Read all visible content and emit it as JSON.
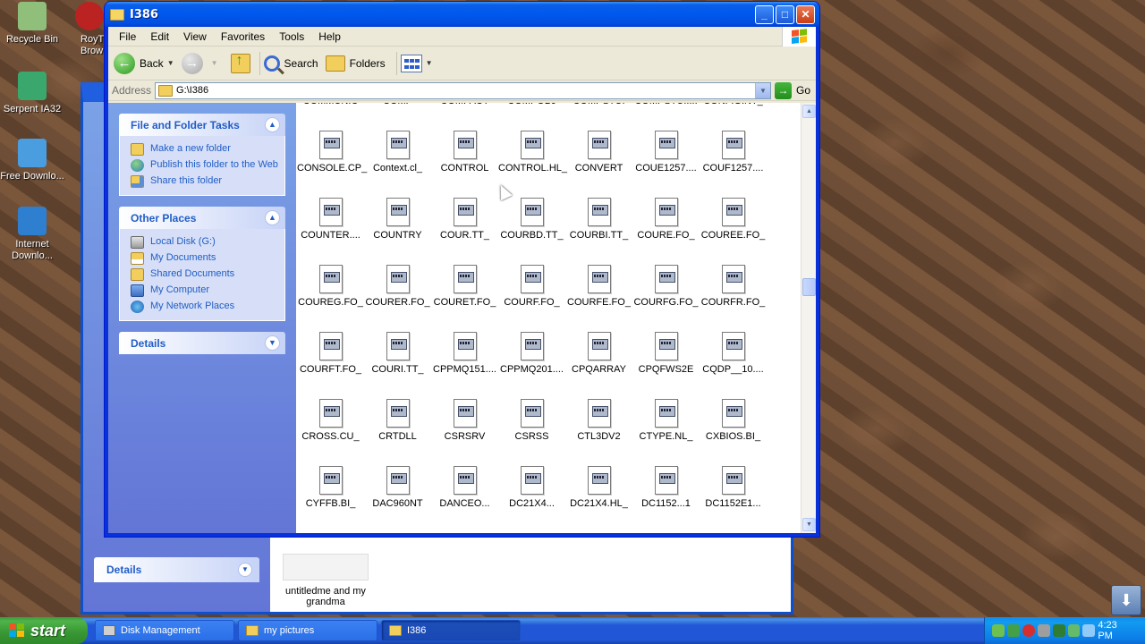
{
  "desktop": {
    "icons": [
      {
        "label": "Recycle Bin",
        "icon": "recycle-bin-icon",
        "color": "#8fbf7a"
      },
      {
        "label": "Serpent IA32",
        "icon": "serpent-icon",
        "color": "#3aa76d"
      },
      {
        "label": "Free Downlo...",
        "icon": "download-icon",
        "color": "#4a9ee0"
      },
      {
        "label": "Internet Downlo...",
        "icon": "internet-download-icon",
        "color": "#2f7fd1"
      }
    ],
    "partial_icon_label": "RoyT Brow"
  },
  "background_window": {
    "details_label": "Details",
    "file_label": "untitledme and my grandma"
  },
  "window": {
    "title": "I386",
    "menu": [
      "File",
      "Edit",
      "View",
      "Favorites",
      "Tools",
      "Help"
    ],
    "toolbar": {
      "back": "Back",
      "search": "Search",
      "folders": "Folders"
    },
    "address": {
      "label": "Address",
      "value": "G:\\I386",
      "go": "Go"
    },
    "task_pane": {
      "file_tasks": {
        "title": "File and Folder Tasks",
        "links": [
          "Make a new folder",
          "Publish this folder to the Web",
          "Share this folder"
        ]
      },
      "other_places": {
        "title": "Other Places",
        "links": [
          "Local Disk (G:)",
          "My Documents",
          "Shared Documents",
          "My Computer",
          "My Network Places"
        ]
      },
      "details": {
        "title": "Details"
      }
    },
    "files": [
      "COMMUNIC",
      "COMP",
      "COMPACT",
      "COMPOBJ",
      "COMPSTUI",
      "COMPSTUI....",
      "CONFIG.NT_",
      "CONSOLE.CP_",
      "Context.cl_",
      "CONTROL",
      "CONTROL.HL_",
      "CONVERT",
      "COUE1257....",
      "COUF1257....",
      "COUNTER....",
      "COUNTRY",
      "COUR.TT_",
      "COURBD.TT_",
      "COURBI.TT_",
      "COURE.FO_",
      "COUREE.FO_",
      "COUREG.FO_",
      "COURER.FO_",
      "COURET.FO_",
      "COURF.FO_",
      "COURFE.FO_",
      "COURFG.FO_",
      "COURFR.FO_",
      "COURFT.FO_",
      "COURI.TT_",
      "CPPMQ151....",
      "CPPMQ201....",
      "CPQARRAY",
      "CPQFWS2E",
      "CQDP__10....",
      "CROSS.CU_",
      "CRTDLL",
      "CSRSRV",
      "CSRSS",
      "CTL3DV2",
      "CTYPE.NL_",
      "CXBIOS.BI_",
      "CYFFB.BI_",
      "DAC960NT",
      "DANCEO...",
      "DC21X4...",
      "DC21X4.HL_",
      "DC1152...1",
      "DC1152E1..."
    ]
  },
  "taskbar": {
    "start": "start",
    "tasks": [
      {
        "label": "Disk Management",
        "active": false
      },
      {
        "label": "my pictures",
        "active": false
      },
      {
        "label": "I386",
        "active": true
      }
    ],
    "clock": "4:23 PM"
  }
}
